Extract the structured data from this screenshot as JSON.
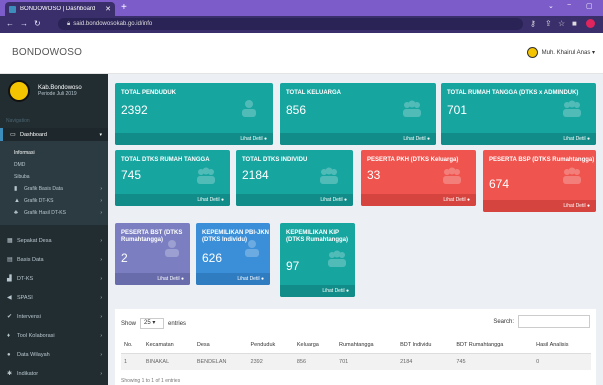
{
  "browser": {
    "tab_title": "BONDOWOSO | Dashboard",
    "tab_close": "✕",
    "new_tab": "+",
    "url": "said.bondowosokab.go.id/info",
    "window": {
      "minimize": "⌄",
      "restore": "−",
      "close": "▢"
    }
  },
  "header": {
    "brand": "BONDOWOSO",
    "user_name": "Muh. Khairul Anas ▾"
  },
  "sidebar": {
    "org_name": "Kab.Bondowoso",
    "period": "Periode Juli 2019",
    "section_label": "Navigation",
    "items": [
      {
        "label": "Dashboard",
        "icon": "monitor-icon"
      },
      {
        "label": "Sepakat Desa",
        "icon": "grid-icon"
      },
      {
        "label": "Basis Data",
        "icon": "database-icon"
      },
      {
        "label": "DT-KS",
        "icon": "bar-chart-icon"
      },
      {
        "label": "SPASI",
        "icon": "megaphone-icon"
      },
      {
        "label": "Intervensi",
        "icon": "check-icon"
      },
      {
        "label": "Tool Kolaborasi",
        "icon": "pin-icon"
      },
      {
        "label": "Data Wilayah",
        "icon": "globe-icon"
      },
      {
        "label": "Indikator",
        "icon": "cog-icon"
      }
    ],
    "subitems": [
      {
        "label": "Informasi"
      },
      {
        "label": "DMD"
      },
      {
        "label": "Sibuba"
      },
      {
        "label": "Grafik Basis Data"
      },
      {
        "label": "Grafik DT-KS"
      },
      {
        "label": "Grafik Hasil DT-KS"
      }
    ]
  },
  "boxes": [
    {
      "title": "TOTAL PENDUDUK",
      "value": "2392",
      "footer": "Lihat Detil ●"
    },
    {
      "title": "TOTAL KELUARGA",
      "value": "856",
      "footer": "Lihat Detil ●"
    },
    {
      "title": "TOTAL RUMAH TANGGA (DTKS x ADMINDUK)",
      "value": "701",
      "footer": "Lihat Detil ●"
    },
    {
      "title": "TOTAL DTKS RUMAH TANGGA",
      "value": "745",
      "footer": "Lihat Detil ●"
    },
    {
      "title": "TOTAL DTKS INDIVIDU",
      "value": "2184",
      "footer": "Lihat Detil ●"
    },
    {
      "title": "PESERTA PKH (DTKS Keluarga)",
      "value": "33",
      "footer": "Lihat Detil ●"
    },
    {
      "title": "PESERTA BSP (DTKS Rumahtangga)",
      "value": "674",
      "footer": "Lihat Detil ●"
    },
    {
      "title": "PESERTA BST (DTKS Rumahtangga)",
      "value": "2",
      "footer": "Lihat Detil ●"
    },
    {
      "title": "KEPEMILIKAN PBI-JKN (DTKS Individu)",
      "value": "626",
      "footer": "Lihat Detil ●"
    },
    {
      "title": "KEPEMILIKAN KIP (DTKS Rumahtangga)",
      "value": "97",
      "footer": "Lihat Detil ●"
    }
  ],
  "table": {
    "show_label": "Show",
    "show_value": "25",
    "entries_label": "entries",
    "search_label": "Search:",
    "columns": [
      "No.",
      "Kecamatan",
      "Desa",
      "Penduduk",
      "Keluarga",
      "Rumahtangga",
      "BDT Individu",
      "BDT Rumahtangga",
      "Hasil Analisis"
    ],
    "rows": [
      [
        "1",
        "BINAKAL",
        "BENDELAN",
        "2392",
        "856",
        "701",
        "2184",
        "745",
        "0"
      ]
    ],
    "info": "Showing 1 to 1 of 1 entries"
  },
  "colors": {
    "teal": "#17a5a0",
    "red": "#f0544e",
    "violet": "#7b7fc2",
    "blue": "#3b8fd8",
    "sidebar": "#222d32"
  }
}
